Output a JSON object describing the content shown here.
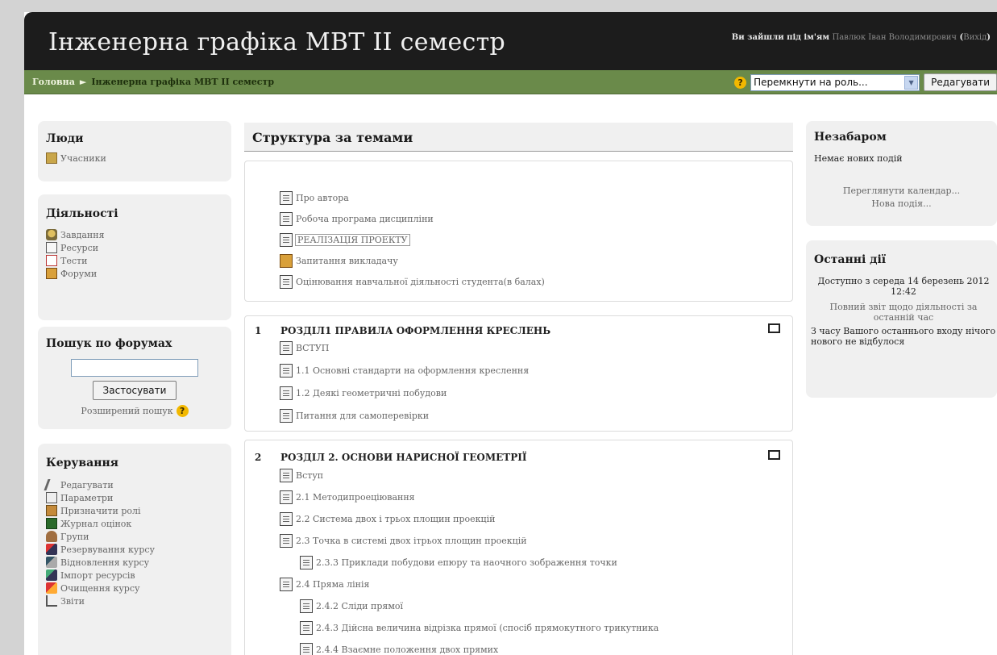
{
  "header": {
    "site_title": "Інженерна графіка МВТ ІІ семестр",
    "login_prefix": "Ви зайшли під ім'ям",
    "login_user": "Павлюк Іван Володимирович",
    "logout_label": "Вихід"
  },
  "navbar": {
    "home": "Головна",
    "separator": "►",
    "current": "Інженерна графіка МВТ ІІ семестр",
    "role_select_value": "Перемкнути на роль...",
    "edit_button": "Редагувати"
  },
  "left": {
    "people": {
      "title": "Люди",
      "items": [
        {
          "label": "Учасники",
          "icon": "people-icon"
        }
      ]
    },
    "activities": {
      "title": "Діяльності",
      "items": [
        {
          "label": "Завдання",
          "icon": "assignment-icon"
        },
        {
          "label": "Ресурси",
          "icon": "resource-icon"
        },
        {
          "label": "Тести",
          "icon": "quiz-icon"
        },
        {
          "label": "Форуми",
          "icon": "forum-icon"
        }
      ]
    },
    "forum_search": {
      "title": "Пошук по форумах",
      "input_value": "",
      "button": "Застосувати",
      "advanced": "Розширений пошук"
    },
    "admin": {
      "title": "Керування",
      "items": [
        {
          "label": "Редагувати",
          "icon": "edit-icon"
        },
        {
          "label": "Параметри",
          "icon": "settings-icon"
        },
        {
          "label": "Призначити ролі",
          "icon": "roles-icon"
        },
        {
          "label": "Журнал оцінок",
          "icon": "grades-icon"
        },
        {
          "label": "Групи",
          "icon": "groups-icon"
        },
        {
          "label": "Резервування курсу",
          "icon": "backup-icon"
        },
        {
          "label": "Відновлення курсу",
          "icon": "restore-icon"
        },
        {
          "label": "Імпорт ресурсів",
          "icon": "import-icon"
        },
        {
          "label": "Очищення курсу",
          "icon": "reset-icon"
        },
        {
          "label": "Звіти",
          "icon": "reports-icon"
        }
      ]
    }
  },
  "center": {
    "title": "Структура за темами",
    "section0": [
      "Про автора",
      "Робоча програма дисципліни",
      "РЕАЛІЗАЦІЯ ПРОЕКТУ",
      "Запитання викладачу",
      "Оцінювання навчальної діяльності студента(в балах)"
    ],
    "section1": {
      "number": "1",
      "title": "РОЗДІЛ1 ПРАВИЛА ОФОРМЛЕННЯ КРЕСЛЕНЬ",
      "items": [
        "ВСТУП",
        "1.1 Основні стандарти на оформлення креслення",
        "1.2 Деякі геометричні побудови",
        "Питання для самоперевірки"
      ]
    },
    "section2": {
      "number": "2",
      "title": "РОЗДІЛ 2. ОСНОВИ НАРИСНОЇ ГЕОМЕТРІЇ",
      "items": [
        "Вступ",
        "2.1 Методипроеціювання",
        "2.2 Система двох і трьох площин проекцій",
        "2.3 Точка в системі двох ітрьох площин проекцій",
        "2.3.3 Приклади побудови епюру та наочного зображення точки",
        "2.4 Пряма лінія",
        "2.4.2 Сліди прямої",
        "2.4.3 Дійсна величина відрізка прямої (спосіб прямокутного трикутника",
        "2.4.4 Взаємне положення двох прямих"
      ]
    }
  },
  "right": {
    "upcoming": {
      "title": "Незабаром",
      "no_events": "Немає нових подій",
      "calendar_link": "Переглянути календар...",
      "new_event_link": "Нова подія..."
    },
    "recent": {
      "title": "Останні дії",
      "since": "Доступно з середа 14 березень 2012 12:42",
      "full_report": "Повний звіт щодо діяльності за останній час",
      "nothing_new": "З часу Вашого останнього входу нічого нового не відбулося"
    }
  }
}
